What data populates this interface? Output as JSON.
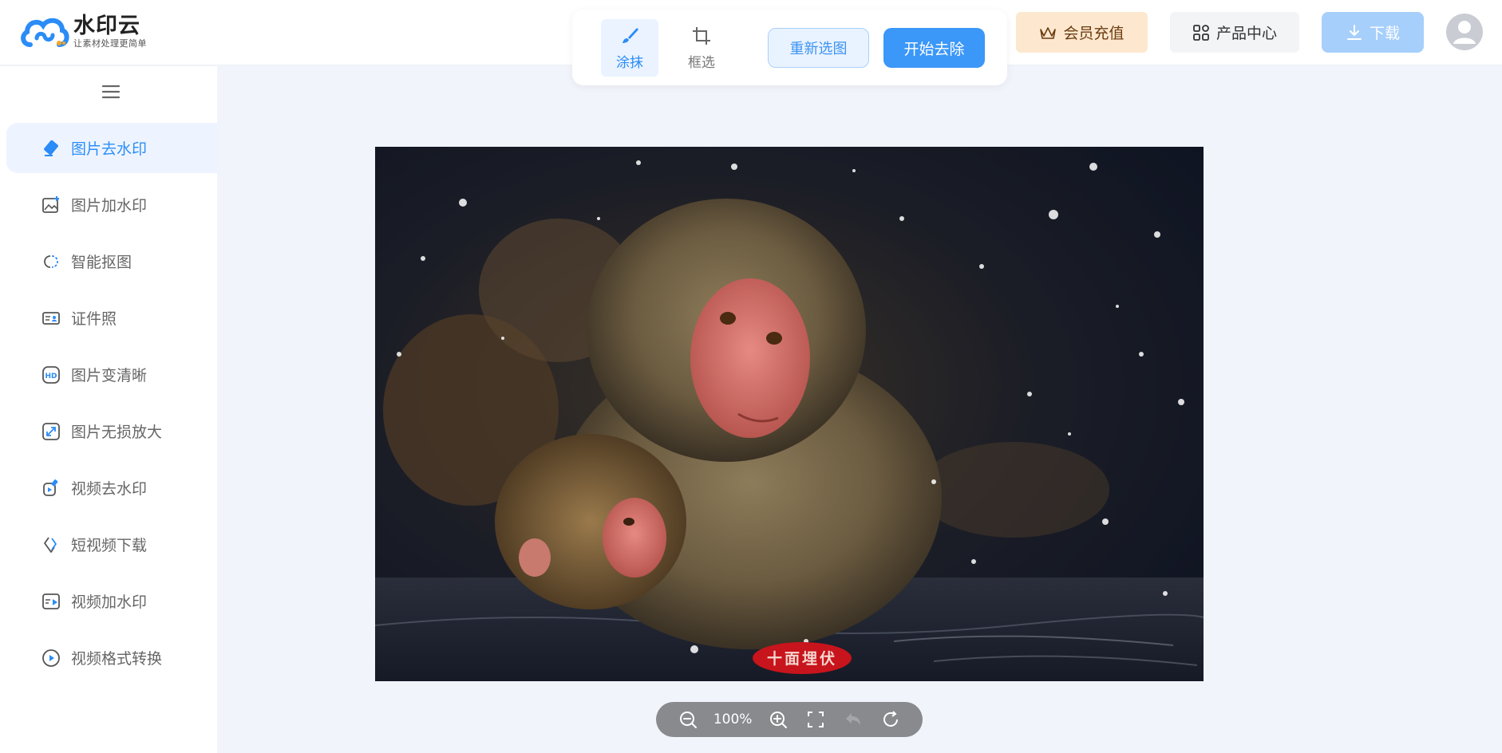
{
  "brand": {
    "name": "水印云",
    "slogan": "让素材处理更简单",
    "colors": {
      "primary": "#2b8cf7",
      "vip": "#fde8cf",
      "accent_orange": "#f5a623"
    }
  },
  "toolbar": {
    "tools": [
      {
        "label": "涂抹",
        "icon": "brush-icon",
        "active": true
      },
      {
        "label": "框选",
        "icon": "crop-icon",
        "active": false
      }
    ],
    "reselect_label": "重新选图",
    "start_label": "开始去除"
  },
  "header": {
    "vip_label": "会员充值",
    "product_label": "产品中心",
    "download_label": "下载"
  },
  "sidebar": {
    "items": [
      {
        "label": "图片去水印",
        "icon": "eraser-icon",
        "active": true
      },
      {
        "label": "图片加水印",
        "icon": "image-add-icon",
        "active": false
      },
      {
        "label": "智能抠图",
        "icon": "cutout-icon",
        "active": false
      },
      {
        "label": "证件照",
        "icon": "id-card-icon",
        "active": false
      },
      {
        "label": "图片变清晰",
        "icon": "hd-icon",
        "active": false
      },
      {
        "label": "图片无损放大",
        "icon": "enlarge-icon",
        "active": false
      },
      {
        "label": "视频去水印",
        "icon": "video-eraser-icon",
        "active": false
      },
      {
        "label": "短视频下载",
        "icon": "link-download-icon",
        "active": false
      },
      {
        "label": "视频加水印",
        "icon": "video-add-icon",
        "active": false
      },
      {
        "label": "视频格式转换",
        "icon": "play-circle-icon",
        "active": false
      }
    ]
  },
  "canvas": {
    "watermark_text": "十面埋伏",
    "zoom": "100%"
  }
}
